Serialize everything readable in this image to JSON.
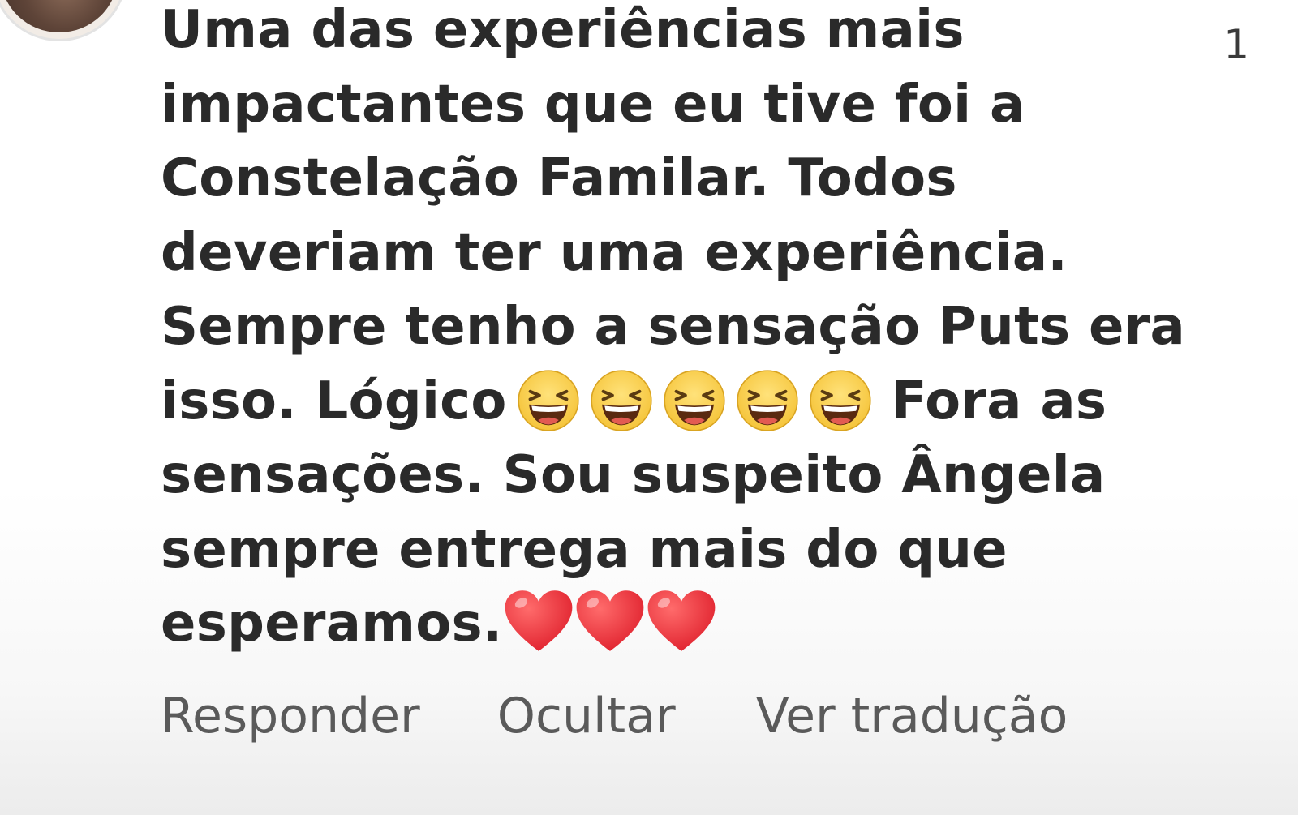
{
  "comment": {
    "lines": [
      "Uma das experiências mais",
      "impactantes que eu tive foi a",
      "Constelação Familar.  Todos",
      "deveriam ter uma experiência.",
      "Sempre tenho a sensação Puts era",
      "isso.  Lógico",
      "Fora as",
      "sensações.  Sou suspeito Ângela",
      "sempre entrega mais do que",
      "esperamos."
    ],
    "emojis": {
      "laugh": "grinning-squinting-face-icon",
      "laugh_count": 5,
      "heart": "red-heart-icon",
      "heart_count": 3
    },
    "like_count": "1"
  },
  "actions": {
    "reply": "Responder",
    "hide": "Ocultar",
    "translate": "Ver tradução"
  },
  "colors": {
    "text": "#262626",
    "secondary": "#5a5a5a",
    "heart": "#e0222e",
    "emoji_face": "#f5c43a"
  }
}
